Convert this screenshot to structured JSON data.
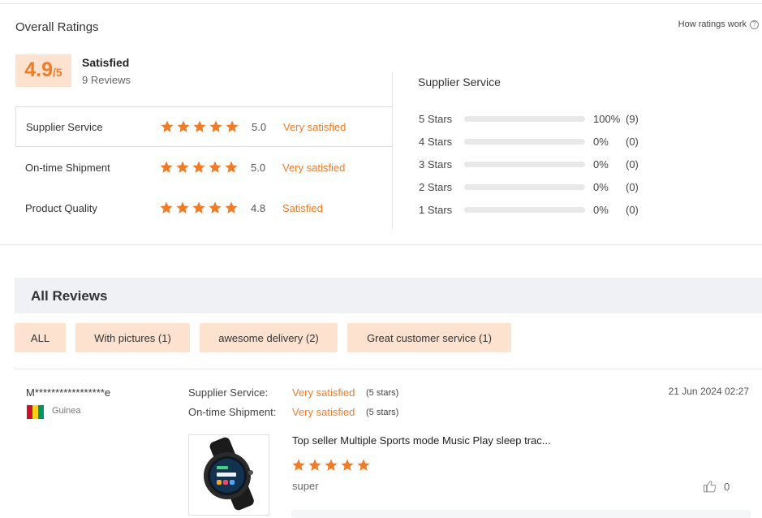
{
  "header": {
    "title": "Overall Ratings",
    "how_ratings": "How ratings work",
    "help_icon": "question-circle-icon"
  },
  "summary": {
    "score": "4.9",
    "out_of": "/5",
    "label": "Satisfied",
    "reviews": "9 Reviews"
  },
  "metrics": [
    {
      "name": "Supplier Service",
      "score": "5.0",
      "verdict": "Very satisfied",
      "rating": 5.0
    },
    {
      "name": "On-time Shipment",
      "score": "5.0",
      "verdict": "Very satisfied",
      "rating": 5.0
    },
    {
      "name": "Product Quality",
      "score": "4.8",
      "verdict": "Satisfied",
      "rating": 4.8
    }
  ],
  "distribution": {
    "title": "Supplier Service",
    "rows": [
      {
        "label": "5 Stars",
        "pct": "100%",
        "count": "(9)",
        "fraction": 1.0
      },
      {
        "label": "4 Stars",
        "pct": "0%",
        "count": "(0)",
        "fraction": 0
      },
      {
        "label": "3 Stars",
        "pct": "0%",
        "count": "(0)",
        "fraction": 0
      },
      {
        "label": "2 Stars",
        "pct": "0%",
        "count": "(0)",
        "fraction": 0
      },
      {
        "label": "1 Stars",
        "pct": "0%",
        "count": "(0)",
        "fraction": 0
      }
    ]
  },
  "reviews_section": {
    "title": "All Reviews",
    "filters": [
      {
        "label": "ALL"
      },
      {
        "label": "With pictures (1)"
      },
      {
        "label": "awesome delivery (2)"
      },
      {
        "label": "Great customer service (1)"
      }
    ]
  },
  "review": {
    "reviewer": "M*****************e",
    "country": "Guinea",
    "flag_colors": [
      "#ce1126",
      "#fcd116",
      "#009460"
    ],
    "supplier_label": "Supplier Service:",
    "supplier_verdict": "Very satisfied",
    "supplier_stars": "(5 stars)",
    "shipment_label": "On-time Shipment:",
    "shipment_verdict": "Very satisfied",
    "shipment_stars": "(5 stars)",
    "date": "21 Jun 2024 02:27",
    "product_title": "Top seller Multiple Sports mode Music Play sleep trac...",
    "rating": 5,
    "text": "super",
    "likes": "0",
    "like_icon": "thumbs-up-icon"
  },
  "colors": {
    "accent": "#f07c28",
    "chip_bg": "#fde3cf",
    "section_bg": "#f0f1f4"
  }
}
